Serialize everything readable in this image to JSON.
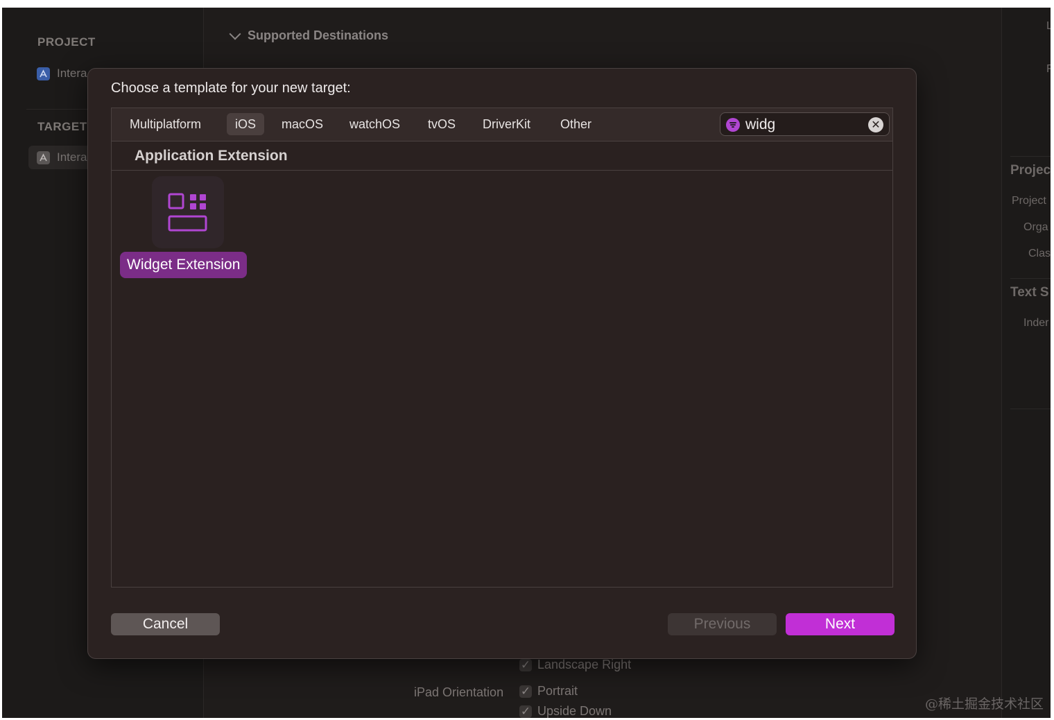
{
  "navigator": {
    "project_header": "PROJECT",
    "project_item": "Intera",
    "targets_header": "TARGET",
    "target_item": "Intera"
  },
  "editor": {
    "section_title": "Supported Destinations",
    "landscape_right": "Landscape Right",
    "ipad_orientation_label": "iPad Orientation",
    "portrait": "Portrait",
    "upside_down": "Upside Down"
  },
  "inspector": {
    "top_label_1": "L",
    "top_label_2": "F",
    "project_header": "Projec",
    "project_label": "Project",
    "org_label": "Orga",
    "class_label": "Clas",
    "text_settings_header": "Text S",
    "indent_label": "Inder"
  },
  "dialog": {
    "title": "Choose a template for your new target:",
    "tabs": [
      "Multiplatform",
      "iOS",
      "macOS",
      "watchOS",
      "tvOS",
      "DriverKit",
      "Other"
    ],
    "active_tab": "iOS",
    "search": {
      "value": "widg"
    },
    "section_title": "Application Extension",
    "template_label": "Widget Extension",
    "accent_color": "#c12fd6",
    "buttons": {
      "cancel": "Cancel",
      "previous": "Previous",
      "next": "Next"
    }
  },
  "watermark": "@稀土掘金技术社区"
}
